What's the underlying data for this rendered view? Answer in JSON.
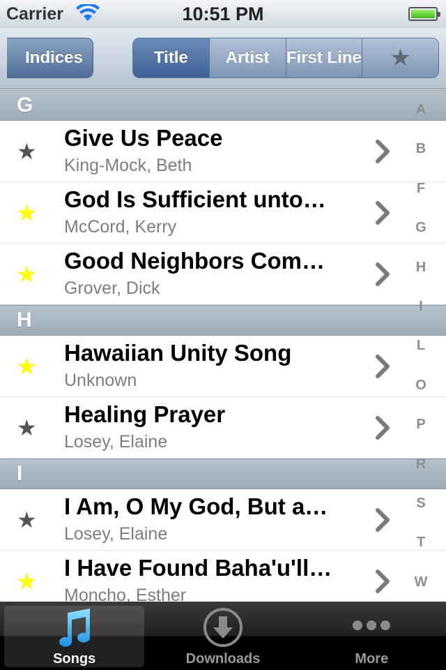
{
  "status_bar": {
    "carrier": "Carrier",
    "time": "10:51 PM"
  },
  "nav": {
    "back_label": "Indices",
    "segments": [
      "Title",
      "Artist",
      "First Line"
    ],
    "selected_segment": "Title",
    "star_segment_icon": "star-icon"
  },
  "sections": [
    {
      "header": "G",
      "rows": [
        {
          "title": "Give Us Peace",
          "subtitle": "King-Mock, Beth",
          "favorite": false
        },
        {
          "title": "God Is Sufficient unto…",
          "subtitle": "McCord, Kerry",
          "favorite": true
        },
        {
          "title": "Good Neighbors Com…",
          "subtitle": "Grover, Dick",
          "favorite": true
        }
      ]
    },
    {
      "header": "H",
      "rows": [
        {
          "title": "Hawaiian Unity Song",
          "subtitle": "Unknown",
          "favorite": true
        },
        {
          "title": "Healing Prayer",
          "subtitle": "Losey, Elaine",
          "favorite": false
        }
      ]
    },
    {
      "header": "I",
      "rows": [
        {
          "title": "I Am, O My God, But a…",
          "subtitle": "Losey, Elaine",
          "favorite": false
        },
        {
          "title": "I Have Found Baha'u'll…",
          "subtitle": "Moncho, Esther",
          "favorite": true
        }
      ]
    }
  ],
  "index_letters": [
    "A",
    "B",
    "F",
    "G",
    "H",
    "I",
    "L",
    "O",
    "P",
    "R",
    "S",
    "T",
    "W"
  ],
  "tabs": [
    {
      "label": "Songs",
      "icon": "music-note-icon",
      "selected": true
    },
    {
      "label": "Downloads",
      "icon": "download-icon",
      "selected": false
    },
    {
      "label": "More",
      "icon": "more-icon",
      "selected": false
    }
  ],
  "colors": {
    "favorite_star": "#ffff00",
    "plain_star": "#555555",
    "nav_selected": "#3c6198"
  }
}
